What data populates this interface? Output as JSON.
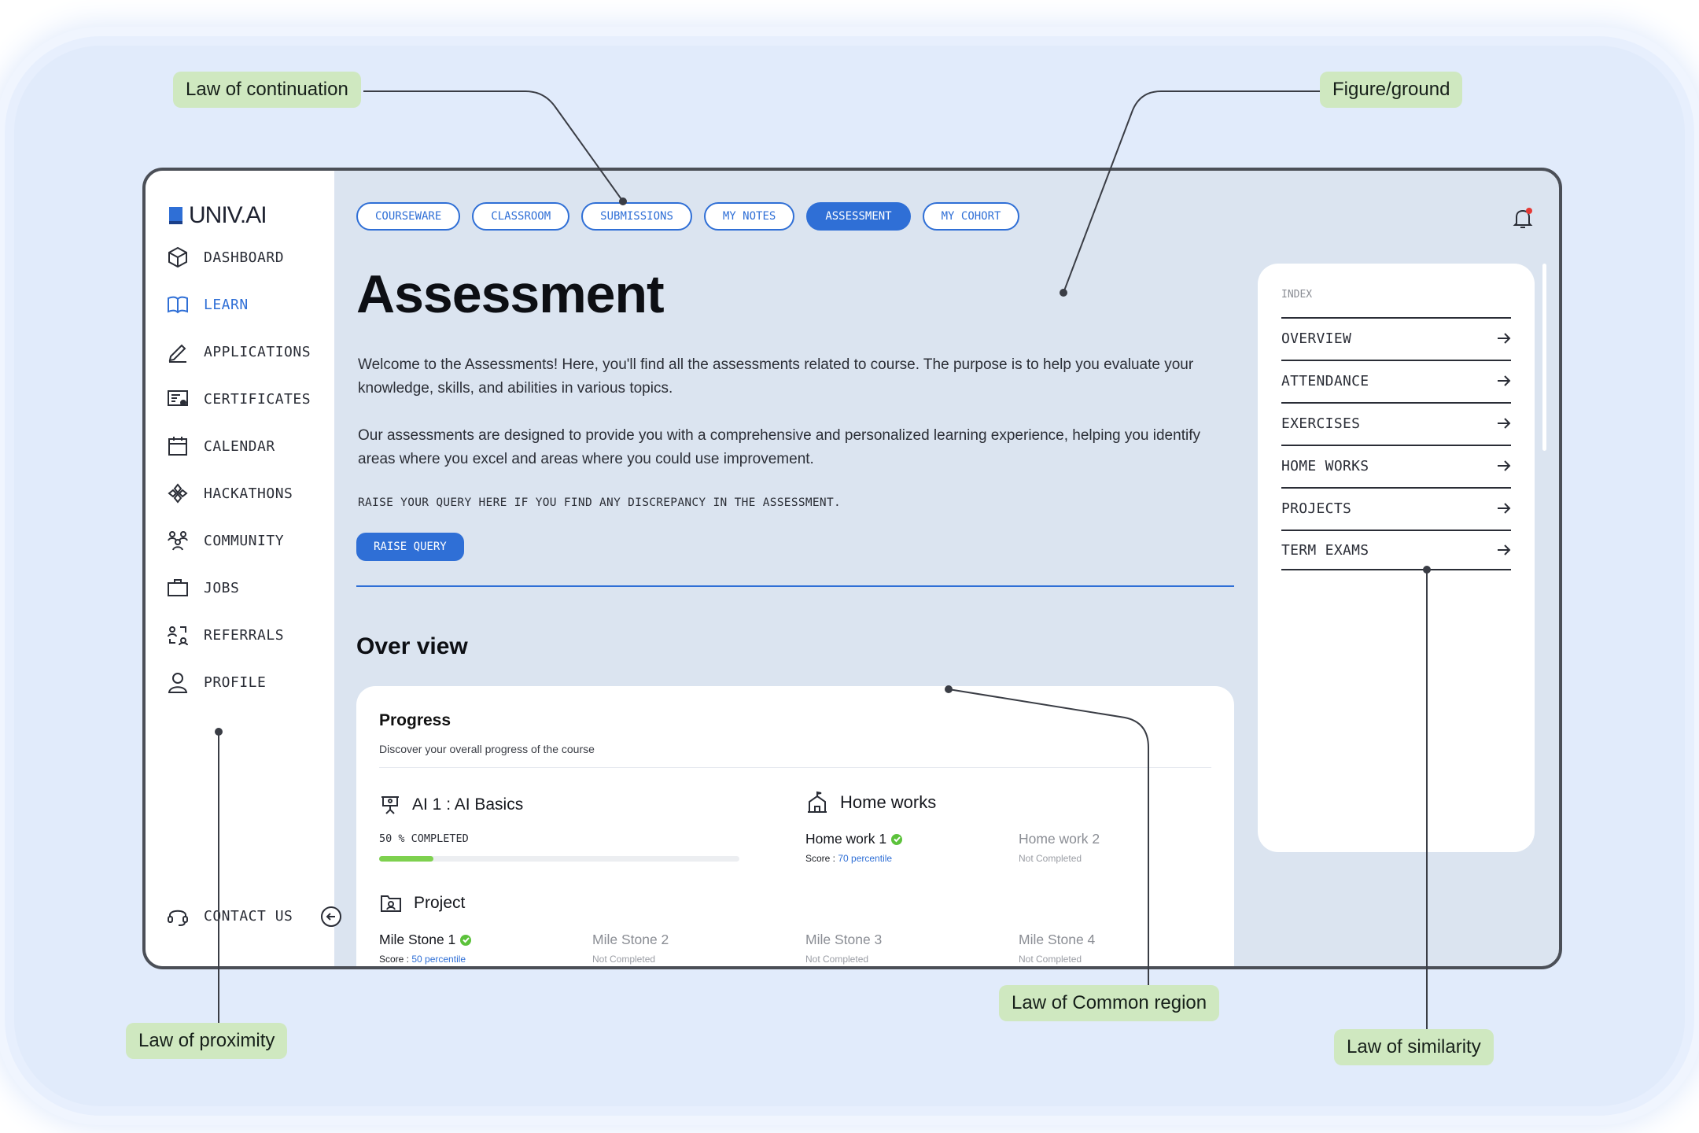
{
  "brand": {
    "logo_text": "UNIV.AI"
  },
  "sidebar": {
    "items": [
      {
        "label": "DASHBOARD",
        "icon": "cube-icon",
        "active": false
      },
      {
        "label": "LEARN",
        "icon": "book-icon",
        "active": true
      },
      {
        "label": "APPLICATIONS",
        "icon": "pencil-icon",
        "active": false
      },
      {
        "label": "CERTIFICATES",
        "icon": "certificate-icon",
        "active": false
      },
      {
        "label": "CALENDAR",
        "icon": "calendar-icon",
        "active": false
      },
      {
        "label": "HACKATHONS",
        "icon": "hackathon-icon",
        "active": false
      },
      {
        "label": "COMMUNITY",
        "icon": "community-icon",
        "active": false
      },
      {
        "label": "JOBS",
        "icon": "briefcase-icon",
        "active": false
      },
      {
        "label": "REFERRALS",
        "icon": "referral-icon",
        "active": false
      },
      {
        "label": "PROFILE",
        "icon": "user-icon",
        "active": false
      }
    ],
    "contact_label": "CONTACT US"
  },
  "tabs": [
    {
      "label": "COURSEWARE",
      "active": false
    },
    {
      "label": "CLASSROOM",
      "active": false
    },
    {
      "label": "SUBMISSIONS",
      "active": false
    },
    {
      "label": "MY NOTES",
      "active": false
    },
    {
      "label": "ASSESSMENT",
      "active": true
    },
    {
      "label": "MY COHORT",
      "active": false
    }
  ],
  "main": {
    "title": "Assessment",
    "paragraph1": "Welcome to the Assessments! Here, you'll find  all the assessments related to course. The purpose is to help you evaluate your knowledge, skills, and abilities in various topics.",
    "paragraph2": "Our assessments are designed to provide you with a comprehensive and personalized learning experience, helping you identify areas where you excel and areas where you could use improvement.",
    "query_text": "RAISE YOUR QUERY HERE IF YOU FIND ANY DISCREPANCY IN THE ASSESSMENT.",
    "raise_query_label": "RAISE QUERY",
    "overview_title": "Over view"
  },
  "progress": {
    "title": "Progress",
    "subtitle": "Discover your overall progress of the course",
    "course_name": "AI 1 : AI Basics",
    "completed_label": "50 % COMPLETED",
    "completed_fraction": 0.5,
    "homeworks_title": "Home works",
    "homeworks": [
      {
        "name": "Home work 1",
        "score_label": "Score : ",
        "score_value": "70 percentile",
        "done": true
      },
      {
        "name": "Home work 2",
        "status": "Not Completed",
        "done": false
      }
    ],
    "project_title": "Project",
    "milestones": [
      {
        "name": "Mile Stone 1",
        "score_label": "Score : ",
        "score_value": "50 percentile",
        "done": true
      },
      {
        "name": "Mile Stone 2",
        "status": "Not Completed",
        "done": false
      },
      {
        "name": "Mile Stone 3",
        "status": "Not Completed",
        "done": false
      },
      {
        "name": "Mile Stone 4",
        "status": "Not Completed",
        "done": false
      }
    ]
  },
  "index": {
    "label": "INDEX",
    "items": [
      "OVERVIEW",
      "ATTENDANCE",
      "EXERCISES",
      "HOME WORKS",
      "PROJECTS",
      "TERM EXAMS"
    ]
  },
  "annotations": {
    "continuation": "Law of continuation",
    "figure_ground": "Figure/ground",
    "common_region": "Law of Common region",
    "proximity": "Law of proximity",
    "similarity": "Law of similarity"
  },
  "colors": {
    "accent": "#2f6fd6",
    "progress": "#7ed14f",
    "annotation_bg": "#cfe8c0",
    "main_bg": "#dbe4f0"
  }
}
